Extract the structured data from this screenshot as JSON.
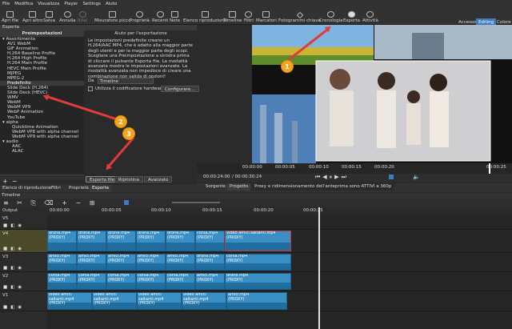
{
  "menu": [
    "File",
    "Modifica",
    "Visualizza",
    "Player",
    "Settings",
    "Aiuto"
  ],
  "toolbar": {
    "open": "Apri file",
    "open_other": "Apri altro",
    "save": "Salva",
    "undo": "Annulla",
    "redo": "Rifai",
    "peak_meter": "Misuratore picco",
    "properties": "Proprietà",
    "recent": "Recenti",
    "notes": "Note",
    "playlist": "Elenco riproduzione",
    "timeline": "Timeline",
    "filters": "Filtri",
    "markers": "Marcatori",
    "keyframes": "Fotogrammi chiave",
    "history": "Cronologia",
    "export": "Esporta",
    "jobs": "Attività",
    "layouts": [
      "Accesso",
      "Editing",
      "Colore"
    ]
  },
  "export_panel": {
    "title": "Esporta",
    "presets_title": "Preimpostazioni",
    "presets": [
      {
        "label": "▾ Assortimento",
        "indent": 0
      },
      {
        "label": "AV1 WebM",
        "indent": 1
      },
      {
        "label": "GIF Animation",
        "indent": 1
      },
      {
        "label": "H.264 Baseline Profile",
        "indent": 1
      },
      {
        "label": "H.264 High Profile",
        "indent": 1
      },
      {
        "label": "H.264 Main Profile",
        "indent": 1
      },
      {
        "label": "HEVC Main Profile",
        "indent": 1
      },
      {
        "label": "MJPEG",
        "indent": 1
      },
      {
        "label": "MPEG-2",
        "indent": 1
      },
      {
        "label": "Predefinito",
        "indent": 1,
        "selected": true
      },
      {
        "label": "Slide Deck (H.264)",
        "indent": 1
      },
      {
        "label": "Slide Deck (HEVC)",
        "indent": 1
      },
      {
        "label": "WMV",
        "indent": 1
      },
      {
        "label": "WebM",
        "indent": 1
      },
      {
        "label": "WebM VP9",
        "indent": 1
      },
      {
        "label": "WebP Animation",
        "indent": 1
      },
      {
        "label": "YouTube",
        "indent": 1
      },
      {
        "label": "▾ alpha",
        "indent": 0
      },
      {
        "label": "Quicktime Animation",
        "indent": 2
      },
      {
        "label": "WebM VP8 with alpha channel",
        "indent": 2
      },
      {
        "label": "WebM VP9 with alpha channel",
        "indent": 2
      },
      {
        "label": "▾ audio",
        "indent": 0
      },
      {
        "label": "AAC",
        "indent": 2
      },
      {
        "label": "ALAC",
        "indent": 2
      }
    ],
    "help_title": "Aiuto per l'esportazione",
    "help_text": "Le impostazioni predefinite creano un H.264/AAC MP4, che è adatto alla maggior parte degli utenti e per la maggior parte degli scopi. Scegliere una Preimpostazione a sinistra prima di cliccare il pulsante Esporta file. La modalità avanzata mostra le impostazioni avanzate. La modalità avanzata non impedisce di creare una combinazione non valida di opzioni!",
    "from_label": "Da",
    "from_value": "Timeline",
    "hw_encoder": "Utilizza il codificatore hardware",
    "configure": "Configurare...",
    "export_file": "Esporta file",
    "reset": "Ripristina",
    "advanced": "Avanzato"
  },
  "bottom_tabs": [
    "Elenco di riproduzione",
    "Filtri",
    "Proprietà",
    "Esporta"
  ],
  "player": {
    "ruler_ticks": [
      "00:00:00",
      "00:00:05",
      "00:00:10",
      "00:00:15",
      "00:00:20",
      "00:00:25"
    ],
    "timecode": "00:00:24:00",
    "duration": "/ 00:00:30:24",
    "source_tab": "Sorgente",
    "project_tab": "Progetto",
    "proxy_msg": "Proxy e ridimensionamento dell'anteprima sono ATTIVI a 360p"
  },
  "timeline": {
    "title": "Timeline",
    "ruler": [
      "00:00:00",
      "00:00:05",
      "00:00:10",
      "00:00:15",
      "00:00:20",
      "00:00:25"
    ],
    "output_label": "Output",
    "tracks": [
      {
        "name": "V5",
        "clips": []
      },
      {
        "name": "V4",
        "clips": [
          {
            "label": "drone.mp4\n(PROXY)"
          },
          {
            "label": "drone.mp4\n(PROXY)"
          },
          {
            "label": "drone.mp4\n(PROXY)"
          },
          {
            "label": "drone.mp4\n(PROXY)"
          },
          {
            "label": "drone.mp4\n(PROXY)"
          },
          {
            "label": "corsa.mp4\n(PROXY)"
          },
          {
            "label": "video amici saltanti.mp4\n(PROXY)"
          }
        ]
      },
      {
        "name": "V3",
        "clips": [
          {
            "label": "amici.mp4\n(PROXY)"
          },
          {
            "label": "amici.mp4\n(PROXY)"
          },
          {
            "label": "amici.mp4\n(PROXY)"
          },
          {
            "label": "amici.mp4\n(PROXY)"
          },
          {
            "label": "amici.mp4\n(PROXY)"
          },
          {
            "label": "drone.mp4\n(PROXY)"
          },
          {
            "label": "corsa.mp4\n(PROXY)"
          }
        ]
      },
      {
        "name": "V2",
        "clips": [
          {
            "label": "corsa.mp4\n(PROXY)"
          },
          {
            "label": "corsa.mp4\n(PROXY)"
          },
          {
            "label": "corsa.mp4\n(PROXY)"
          },
          {
            "label": "corsa.mp4\n(PROXY)"
          },
          {
            "label": "corsa.mp4\n(PROXY)"
          },
          {
            "label": "amici.mp4\n(PROXY)"
          },
          {
            "label": "drone.mp4\n(PROXY)"
          }
        ]
      },
      {
        "name": "V1",
        "clips": [
          {
            "label": "video amici saltanti.mp4\n(PROXY)"
          },
          {
            "label": "video amici saltanti.mp4\n(PROXY)"
          },
          {
            "label": "video amici saltanti.mp4\n(PROXY)"
          },
          {
            "label": "video amici saltanti.mp4\n(PROXY)"
          },
          {
            "label": "amici.mp4\n(PROXY)"
          }
        ]
      }
    ]
  },
  "callouts": [
    "1",
    "2",
    "3"
  ],
  "colors": {
    "accent": "#3e7bbf",
    "clip": "#3a8fc4",
    "callout": "#f3a51f",
    "arrow": "#e23b3b"
  }
}
